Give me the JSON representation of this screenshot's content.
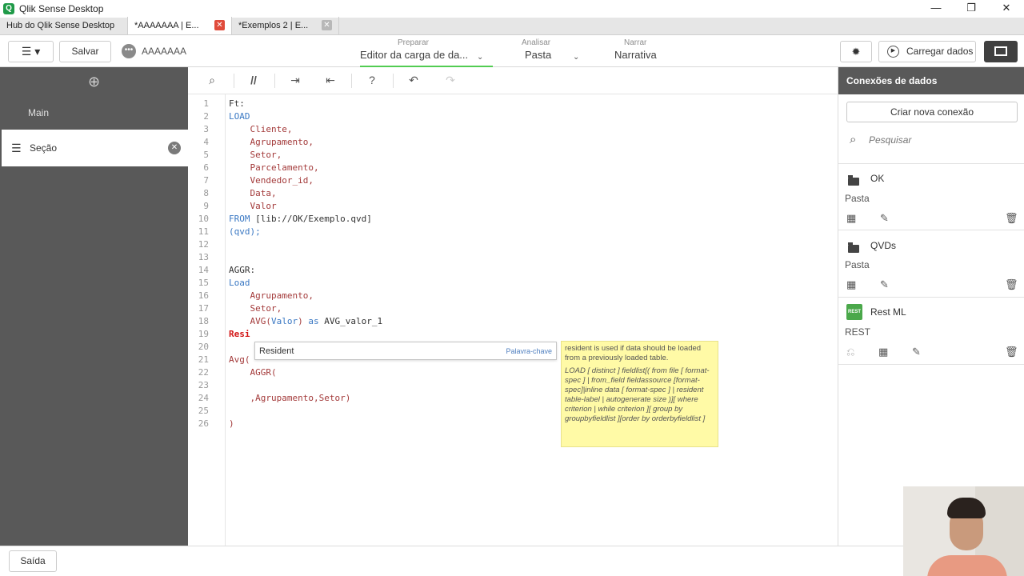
{
  "window": {
    "title": "Qlik Sense Desktop",
    "controls": [
      "—",
      "❐",
      "✕"
    ]
  },
  "tabs": [
    {
      "label": "Hub do Qlik Sense Desktop"
    },
    {
      "label": "*AAAAAAA | E...",
      "close": "✕"
    },
    {
      "label": "*Exemplos 2 | E...",
      "close": "✕"
    }
  ],
  "toolbar": {
    "save_label": "Salvar",
    "app_name": "AAAAAAA",
    "nav": {
      "prepare_small": "Preparar",
      "prepare_big": "Editor da carga de da...",
      "analyze_small": "Analisar",
      "analyze_big": "Pasta",
      "narrate_small": "Narrar",
      "narrate_big": "Narrativa"
    },
    "load_label": "Carregar dados"
  },
  "sections": {
    "main_label": "Main",
    "active_label": "Seção"
  },
  "editor": {
    "line_numbers": [
      "1",
      "2",
      "3",
      "4",
      "5",
      "6",
      "7",
      "8",
      "9",
      "10",
      "11",
      "12",
      "13",
      "14",
      "15",
      "16",
      "17",
      "18",
      "19",
      "20",
      "21",
      "22",
      "23",
      "24",
      "25",
      "26"
    ],
    "lines": {
      "l1": "Ft:",
      "l2": "LOAD",
      "l3": "    Cliente,",
      "l4": "    Agrupamento,",
      "l5": "    Setor,",
      "l6": "    Parcelamento,",
      "l7": "    Vendedor_id,",
      "l8": "    Data,",
      "l9": "    Valor",
      "l10a": "FROM",
      "l10b": " [lib://OK/Exemplo.qvd]",
      "l11": "(qvd);",
      "l14": "AGGR:",
      "l15": "Load",
      "l16": "    Agrupamento,",
      "l17": "    Setor,",
      "l18a": "    AVG(",
      "l18b": "Valor",
      "l18c": ")",
      "l18d": " as",
      "l18e": " AVG_valor_1",
      "l19": "Resi",
      "l21": "Avg(",
      "l22": "    AGGR(",
      "l24": "    ,Agrupamento,Setor)",
      "l26": ")"
    },
    "autocomplete": {
      "name": "Resident",
      "kind": "Palavra-chave"
    },
    "tooltip": {
      "desc": "resident is used if data should be loaded from a previously loaded table.",
      "syntax": "LOAD [ distinct ] fieldlist[( from file [ format-spec ] | from_field fieldassource [format-spec]|inline data [ format-spec ] | resident table-label | autogenerate size )][ where criterion | while criterion ][ group by groupbyfieldlist ][order by orderbyfieldlist ]"
    }
  },
  "connections": {
    "title": "Conexões de dados",
    "new_label": "Criar nova conexão",
    "search_placeholder": "Pesquisar",
    "items": [
      {
        "name": "OK",
        "type": "Pasta"
      },
      {
        "name": "QVDs",
        "type": "Pasta"
      },
      {
        "name": "Rest ML",
        "type": "REST",
        "badge": "REST"
      }
    ]
  },
  "bottom": {
    "exit_label": "Saída"
  }
}
